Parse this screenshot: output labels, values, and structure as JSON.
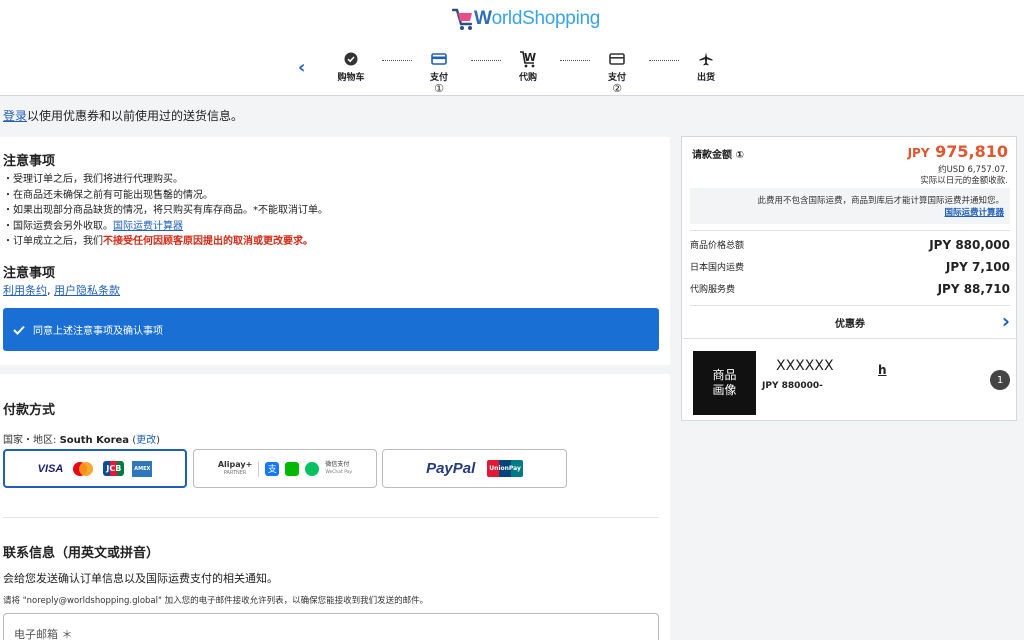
{
  "header": {
    "logo_text_bold": "W",
    "logo_text": "orldShopping",
    "steps": [
      {
        "label": "购物车",
        "num": ""
      },
      {
        "label": "支付",
        "num": "①"
      },
      {
        "label": "代购",
        "num": ""
      },
      {
        "label": "支付",
        "num": "②"
      },
      {
        "label": "出货",
        "num": ""
      }
    ]
  },
  "login": {
    "link": "登录",
    "text": "以使用优惠券和以前使用过的送货信息。"
  },
  "notes": {
    "title": "注意事项",
    "items": [
      "・受理订单之后，我们将进行代理购买。",
      "・在商品还未确保之前有可能出现售罄的情况。",
      "・如果出现部分商品缺货的情况，将只购买有库存商品。*不能取消订单。",
      "・国际运费会另外收取。",
      "・订单成立之后，我们"
    ],
    "shipping_calc_link": "国际运费计算器",
    "red_text": "不接受任何因顾客原因提出的取消或更改要求。",
    "title2": "注意事项",
    "terms_link": "利用条约",
    "terms_sep": ", ",
    "privacy_link": "用户隐私条款",
    "agree_label": "同意上述注意事项及确认事项"
  },
  "payment": {
    "title": "付款方式",
    "country_label": "国家・地区: ",
    "country": "South Korea",
    "change_open": " (",
    "change_link": "更改",
    "change_close": ")",
    "methods": {
      "card": [
        "VISA",
        "JCB",
        "AMEX"
      ],
      "alipay": "Alipay+",
      "alipay_partner": "PARTNER",
      "wechat": "微信支付",
      "wechat_sub": "WeChat Pay",
      "paypal": "PayPal",
      "unionpay": "UnionPay"
    }
  },
  "contact": {
    "title": "联系信息（用英文或拼音）",
    "subtitle": "会给您发送确认订单信息以及国际运费支付的相关通知。",
    "note": "请将 \"noreply@worldshopping.global\" 加入您的电子邮件接收允许列表，以确保您能接收到我们发送的邮件。",
    "email_placeholder": "电子邮箱 ＊"
  },
  "summary": {
    "label": "请款金额 ①",
    "currency": "JPY",
    "total": "975,810",
    "usd": "约USD 6,757.07.",
    "usd_note": "实际以日元的金额收款.",
    "info": "此费用不包含国际运费，商品到库后才能计算国际运费并通知您。",
    "info_link": "国际运费计算器",
    "rows": [
      {
        "label": "商品价格总额",
        "amount": "JPY 880,000"
      },
      {
        "label": "日本国内运费",
        "amount": "JPY 7,100"
      },
      {
        "label": "代购服务费",
        "amount": "JPY 88,710"
      }
    ],
    "coupon_label": "优惠券",
    "item": {
      "image_label_1": "商品",
      "image_label_2": "画像",
      "name": "XXXXXX",
      "price": "JPY 880000-",
      "h": "h",
      "qty": "1"
    }
  },
  "colors": {
    "accent": "#1f5fb8",
    "agree_bar": "#1a6fd4",
    "total": "#e0562f",
    "red": "#d12b17"
  }
}
